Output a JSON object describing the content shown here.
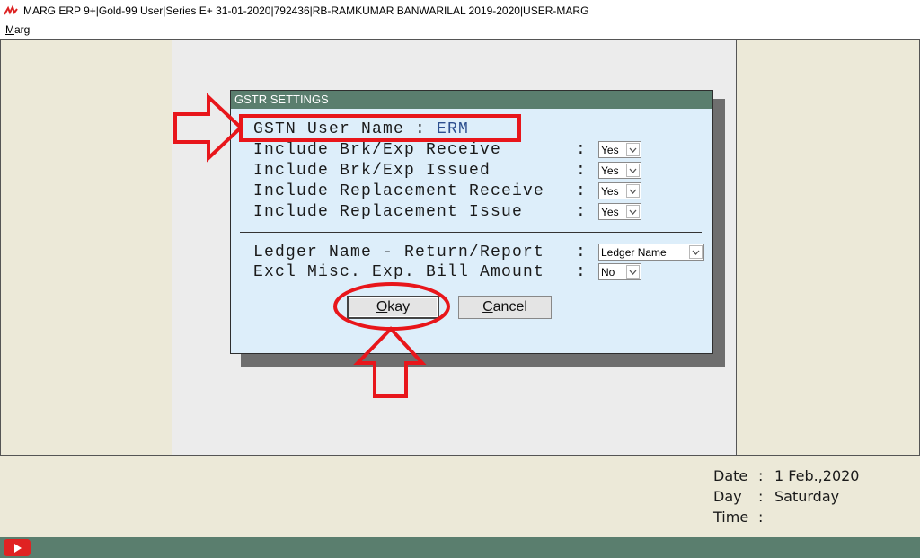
{
  "window": {
    "title": "MARG ERP 9+|Gold-99 User|Series E+ 31-01-2020|792436|RB-RAMKUMAR BANWARILAL 2019-2020|USER-MARG"
  },
  "menu": {
    "items": [
      {
        "accel": "M",
        "rest": "arg"
      }
    ]
  },
  "dialog": {
    "title": "GSTR SETTINGS",
    "user_name_label": "GSTN User Name",
    "user_name_sep": " : ",
    "user_name_value": "ERM",
    "options": [
      {
        "label": "Include Brk/Exp Receive",
        "value": "Yes"
      },
      {
        "label": "Include Brk/Exp Issued",
        "value": "Yes"
      },
      {
        "label": "Include Replacement Receive",
        "value": "Yes"
      },
      {
        "label": "Include Replacement Issue",
        "value": "Yes"
      }
    ],
    "ledger_label": "Ledger Name - Return/Report",
    "ledger_value": "Ledger Name",
    "excl_label": "Excl Misc. Exp. Bill Amount",
    "excl_value": "No",
    "colon": ":",
    "okay": {
      "accel": "O",
      "rest": "kay"
    },
    "cancel": {
      "accel": "C",
      "rest": "ancel"
    }
  },
  "info": {
    "date_label": "Date",
    "date_value": "1 Feb.,2020",
    "day_label": "Day",
    "day_value": "Saturday",
    "time_label": "Time",
    "time_value": "",
    "colon": ":"
  },
  "colors": {
    "title_bar_accent": "#5a7e6e",
    "dialog_bg": "#ddeefa",
    "panel_bg": "#ece9d8",
    "annotation_red": "#e8161b",
    "youtube_red": "#e02222"
  },
  "icons": {
    "app": "marg-logo-icon",
    "dropdown": "chevron-down-icon",
    "youtube": "youtube-play-icon"
  }
}
